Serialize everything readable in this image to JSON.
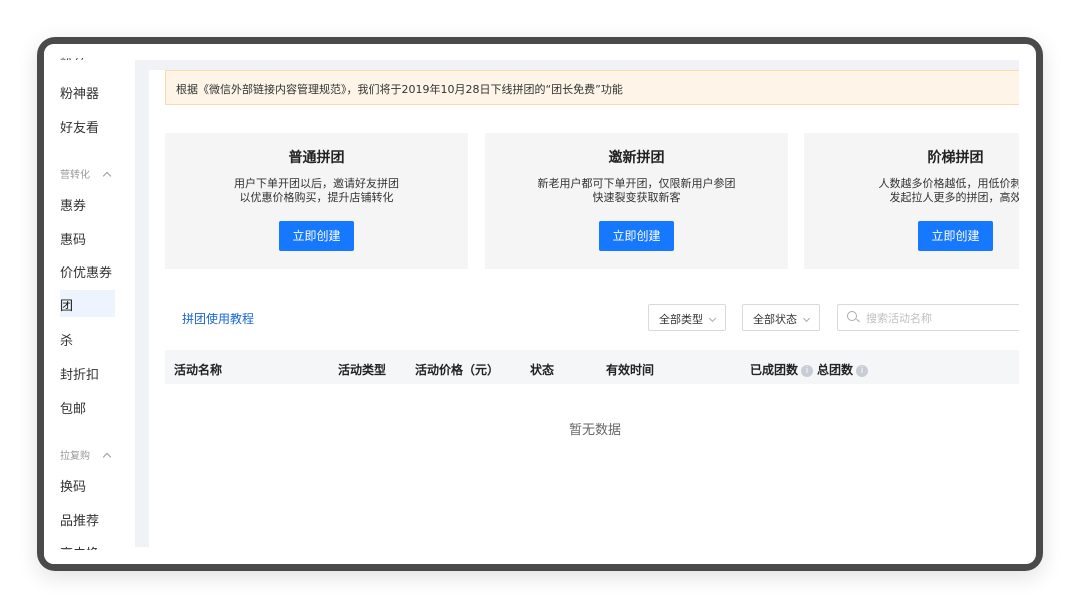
{
  "sidebar": {
    "top_cut": "粉丝",
    "items_a": [
      "粉神器",
      "好友看"
    ],
    "group1": "营转化",
    "items_b": [
      "惠券",
      "惠码",
      "价优惠券",
      "团",
      "杀",
      "封折扣",
      "包邮"
    ],
    "group2": "拉复购",
    "items_c": [
      "换码",
      "品推荐"
    ],
    "bottom_cut": "享去换"
  },
  "notice": "根据《微信外部链接内容管理规范》，我们将于2019年10月28日下线拼团的“团长免费”功能",
  "cards": [
    {
      "title": "普通拼团",
      "desc1": "用户下单开团以后，邀请好友拼团",
      "desc2": "以优惠价格购买，提升店铺转化",
      "button": "立即创建"
    },
    {
      "title": "邀新拼团",
      "desc1": "新老用户都可下单开团，仅限新用户参团",
      "desc2": "快速裂变获取新客",
      "button": "立即创建"
    },
    {
      "title": "阶梯拼团",
      "desc1": "人数越多价格越低，用低价刺激",
      "desc2": "发起拉人更多的拼团，高效",
      "button": "立即创建"
    }
  ],
  "tutorial_link": "拼团使用教程",
  "filters": {
    "type": "全部类型",
    "status": "全部状态",
    "search_placeholder": "搜索活动名称"
  },
  "table": {
    "columns": [
      "活动名称",
      "活动类型",
      "活动价格（元）",
      "状态",
      "有效时间",
      "已成团数",
      "总团数"
    ],
    "info_icon": "i",
    "empty": "暂无数据"
  }
}
